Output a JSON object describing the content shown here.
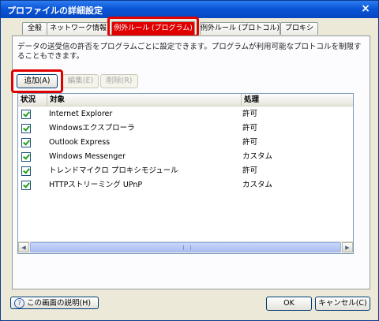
{
  "window": {
    "title": "プロファイルの詳細設定",
    "close_label": "×"
  },
  "tabs": [
    {
      "label": "全般"
    },
    {
      "label": "ネットワーク情報"
    },
    {
      "label": "例外ルール (プログラム)"
    },
    {
      "label": "例外ルール (プロトコル)"
    },
    {
      "label": "プロキシ"
    }
  ],
  "active_tab": "例外ルール (プログラム)",
  "description": "データの送受信の許否をプログラムごとに設定できます。プログラムが利用可能なプロトコルを制限することもできます。",
  "buttons": {
    "add": "追加(A)",
    "edit": "編集(E)",
    "delete": "削除(R)",
    "help": "この画面の説明(H)",
    "ok": "OK",
    "cancel": "キャンセル(C)"
  },
  "list": {
    "columns": [
      "状況",
      "対象",
      "処理"
    ],
    "rows": [
      {
        "checked": true,
        "target": "Internet Explorer",
        "action": "許可"
      },
      {
        "checked": true,
        "target": "Windowsエクスプローラ",
        "action": "許可"
      },
      {
        "checked": true,
        "target": "Outlook Express",
        "action": "許可"
      },
      {
        "checked": true,
        "target": "Windows Messenger",
        "action": "カスタム"
      },
      {
        "checked": true,
        "target": "トレンドマイクロ プロキシモジュール",
        "action": "許可"
      },
      {
        "checked": true,
        "target": "HTTPストリーミング UPnP",
        "action": "カスタム"
      }
    ]
  },
  "colors": {
    "titlebar": "#0a56d8",
    "highlight": "#e00000",
    "checkmark": "#21a121"
  }
}
